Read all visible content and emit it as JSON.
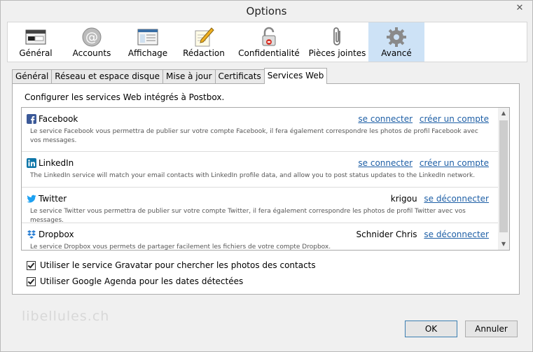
{
  "window": {
    "title": "Options",
    "close_symbol": "✕"
  },
  "toolbar": {
    "items": [
      {
        "label": "Général",
        "icon": "switch-panel-icon"
      },
      {
        "label": "Accounts",
        "icon": "at-sign-icon"
      },
      {
        "label": "Affichage",
        "icon": "window-list-icon"
      },
      {
        "label": "Rédaction",
        "icon": "pencil-paper-icon"
      },
      {
        "label": "Confidentialité",
        "icon": "padlock-icon"
      },
      {
        "label": "Pièces jointes",
        "icon": "paperclip-icon"
      },
      {
        "label": "Avancé",
        "icon": "gear-icon"
      }
    ],
    "active": "Avancé"
  },
  "tabs": {
    "items": [
      "Général",
      "Réseau et espace disque",
      "Mise à jour",
      "Certificats",
      "Services Web"
    ],
    "active": "Services Web"
  },
  "panel": {
    "intro": "Configurer les services Web intégrés à Postbox.",
    "services": [
      {
        "name": "Facebook",
        "user": "",
        "actions": [
          "se connecter",
          "créer un compte"
        ],
        "description": "Le service Facebook vous permettra de publier sur votre compte Facebook, il fera également correspondre les photos de profil Facebook avec vos messages.",
        "color": "#3b5998"
      },
      {
        "name": "LinkedIn",
        "user": "",
        "actions": [
          "se connecter",
          "créer un compte"
        ],
        "description": "The LinkedIn service will match your email contacts with LinkedIn profile data, and allow you to post status updates to the LinkedIn network.",
        "color": "#0e76a8"
      },
      {
        "name": "Twitter",
        "user": "krigou",
        "actions": [
          "se déconnecter"
        ],
        "description": "Le service Twitter vous permettra de publier sur votre compte Twitter, il fera également correspondre les photos de profil Twitter avec vos messages.",
        "color": "#1da1f2"
      },
      {
        "name": "Dropbox",
        "user": "Schnider Chris",
        "actions": [
          "se déconnecter"
        ],
        "description": "Le service Dropbox vous permets de partager facilement les fichiers de votre compte Dropbox.",
        "color": "#2a7fd4"
      }
    ],
    "checkboxes": [
      {
        "label": "Utiliser le service Gravatar pour chercher les photos des contacts",
        "checked": true
      },
      {
        "label": "Utiliser Google Agenda pour les dates détectées",
        "checked": true
      }
    ]
  },
  "watermark": "libellules.ch",
  "buttons": {
    "ok": "OK",
    "cancel": "Annuler"
  }
}
